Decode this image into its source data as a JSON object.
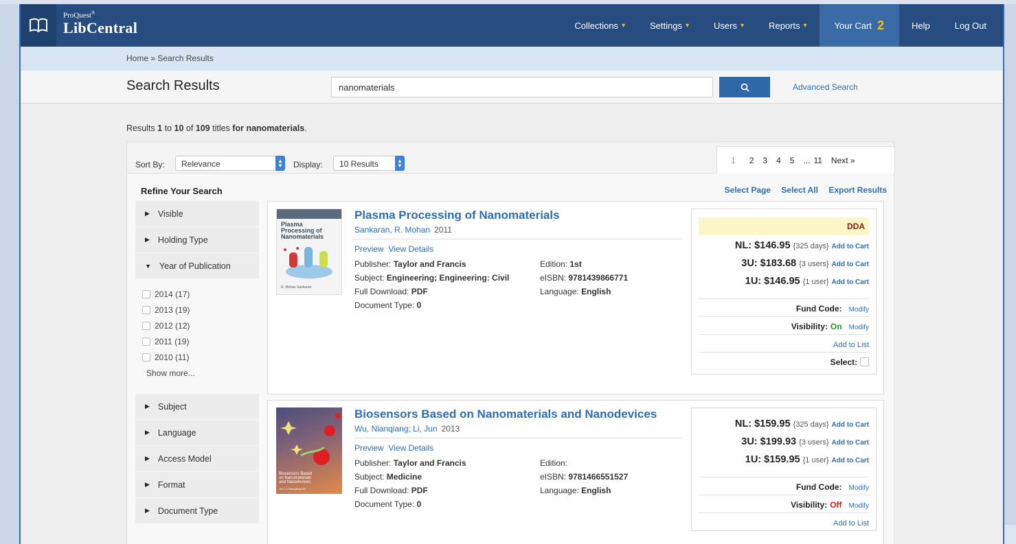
{
  "brand": {
    "small": "ProQuest",
    "small_mark": "®",
    "big": "LibCentral"
  },
  "nav": {
    "collections": "Collections",
    "settings": "Settings",
    "users": "Users",
    "reports": "Reports",
    "cart": "Your Cart",
    "cart_count": "2",
    "help": "Help",
    "logout": "Log Out"
  },
  "breadcrumb": "Home » Search Results",
  "search": {
    "page_title": "Search Results",
    "query": "nanomaterials",
    "advanced": "Advanced Search"
  },
  "summary": {
    "pre": "Results ",
    "from": "1",
    "to_word": " to ",
    "to": "10",
    "of_word": " of ",
    "total": "109",
    "titles_word": " titles ",
    "for_word": "for",
    "term": "nanomaterials",
    "end": "."
  },
  "toolbar": {
    "sort_label": "Sort By:",
    "sort_value": "Relevance",
    "display_label": "Display:",
    "display_value": "10 Results"
  },
  "pager": {
    "p1": "1",
    "p2": "2",
    "p3": "3",
    "p4": "4",
    "p5": "5",
    "ellipsis": "...",
    "p11": "11",
    "next": "Next »"
  },
  "actions": {
    "select_page": "Select Page",
    "select_all": "Select All",
    "export": "Export Results"
  },
  "refine": {
    "title": "Refine Your Search",
    "visible": "Visible",
    "holding": "Holding Type",
    "year": "Year of Publication",
    "years": [
      "2014 (17)",
      "2013 (19)",
      "2012 (12)",
      "2011 (19)",
      "2010 (11)"
    ],
    "show_more": "Show more...",
    "subject": "Subject",
    "language": "Language",
    "access": "Access Model",
    "format": "Format",
    "doctype": "Document Type"
  },
  "books": [
    {
      "title": "Plasma Processing of Nanomaterials",
      "author": "Sankaran, R. Mohan",
      "year": "2011",
      "preview": "Preview",
      "details": "View Details",
      "publisher_label": "Publisher:",
      "publisher": "Taylor and Francis",
      "subject_label": "Subject:",
      "subject": "Engineering; Engineering: Civil",
      "download_label": "Full Download:",
      "download": "PDF",
      "doctype_label": "Document Type:",
      "doctype": "0",
      "edition_label": "Edition:",
      "edition": "1st",
      "isbn_label": "eISBN:",
      "isbn": "9781439866771",
      "language_label": "Language:",
      "language": "English",
      "cover_text1": "Plasma",
      "cover_text2": "Processing of",
      "cover_text3": "Nanomaterials",
      "cover_author": "R. Mohan Sankaran",
      "dda": "DDA",
      "nl_label": "NL:",
      "nl": "$146.95",
      "nl_sub": "{325 days}",
      "u3_label": "3U:",
      "u3": "$183.68",
      "u3_sub": "{3 users}",
      "u1_label": "1U:",
      "u1": "$146.95",
      "u1_sub": "{1 user}",
      "add_cart": "Add to Cart",
      "fund_label": "Fund Code:",
      "modify": "Modify",
      "vis_label": "Visibility:",
      "vis": "On",
      "add_list": "Add to List",
      "select": "Select:"
    },
    {
      "title": "Biosensors Based on Nanomaterials and Nanodevices",
      "author": "Wu, Nianqiang; Li, Jun",
      "year": "2013",
      "preview": "Preview",
      "details": "View Details",
      "publisher_label": "Publisher:",
      "publisher": "Taylor and Francis",
      "subject_label": "Subject:",
      "subject": "Medicine",
      "download_label": "Full Download:",
      "download": "PDF",
      "doctype_label": "Document Type:",
      "doctype": "0",
      "edition_label": "Edition:",
      "edition": "",
      "isbn_label": "eISBN:",
      "isbn": "9781466551527",
      "language_label": "Language:",
      "language": "English",
      "cover_text1": "Biosensors Based",
      "cover_text2": "on Nanomaterials",
      "cover_text3": "and Nanodevices",
      "cover_author": "Jun Li • Nianqiang Wu",
      "nl_label": "NL:",
      "nl": "$159.95",
      "nl_sub": "{325 days}",
      "u3_label": "3U:",
      "u3": "$199.93",
      "u3_sub": "{3 users}",
      "u1_label": "1U:",
      "u1": "$159.95",
      "u1_sub": "{1 user}",
      "add_cart": "Add to Cart",
      "fund_label": "Fund Code:",
      "modify": "Modify",
      "vis_label": "Visibility:",
      "vis": "Off",
      "add_list": "Add to List"
    }
  ],
  "colors": {
    "nav_bg": "#274d80",
    "link": "#2e6db3",
    "accent": "#f5c400",
    "on": "#1aa31a",
    "off": "#d21a1a"
  }
}
